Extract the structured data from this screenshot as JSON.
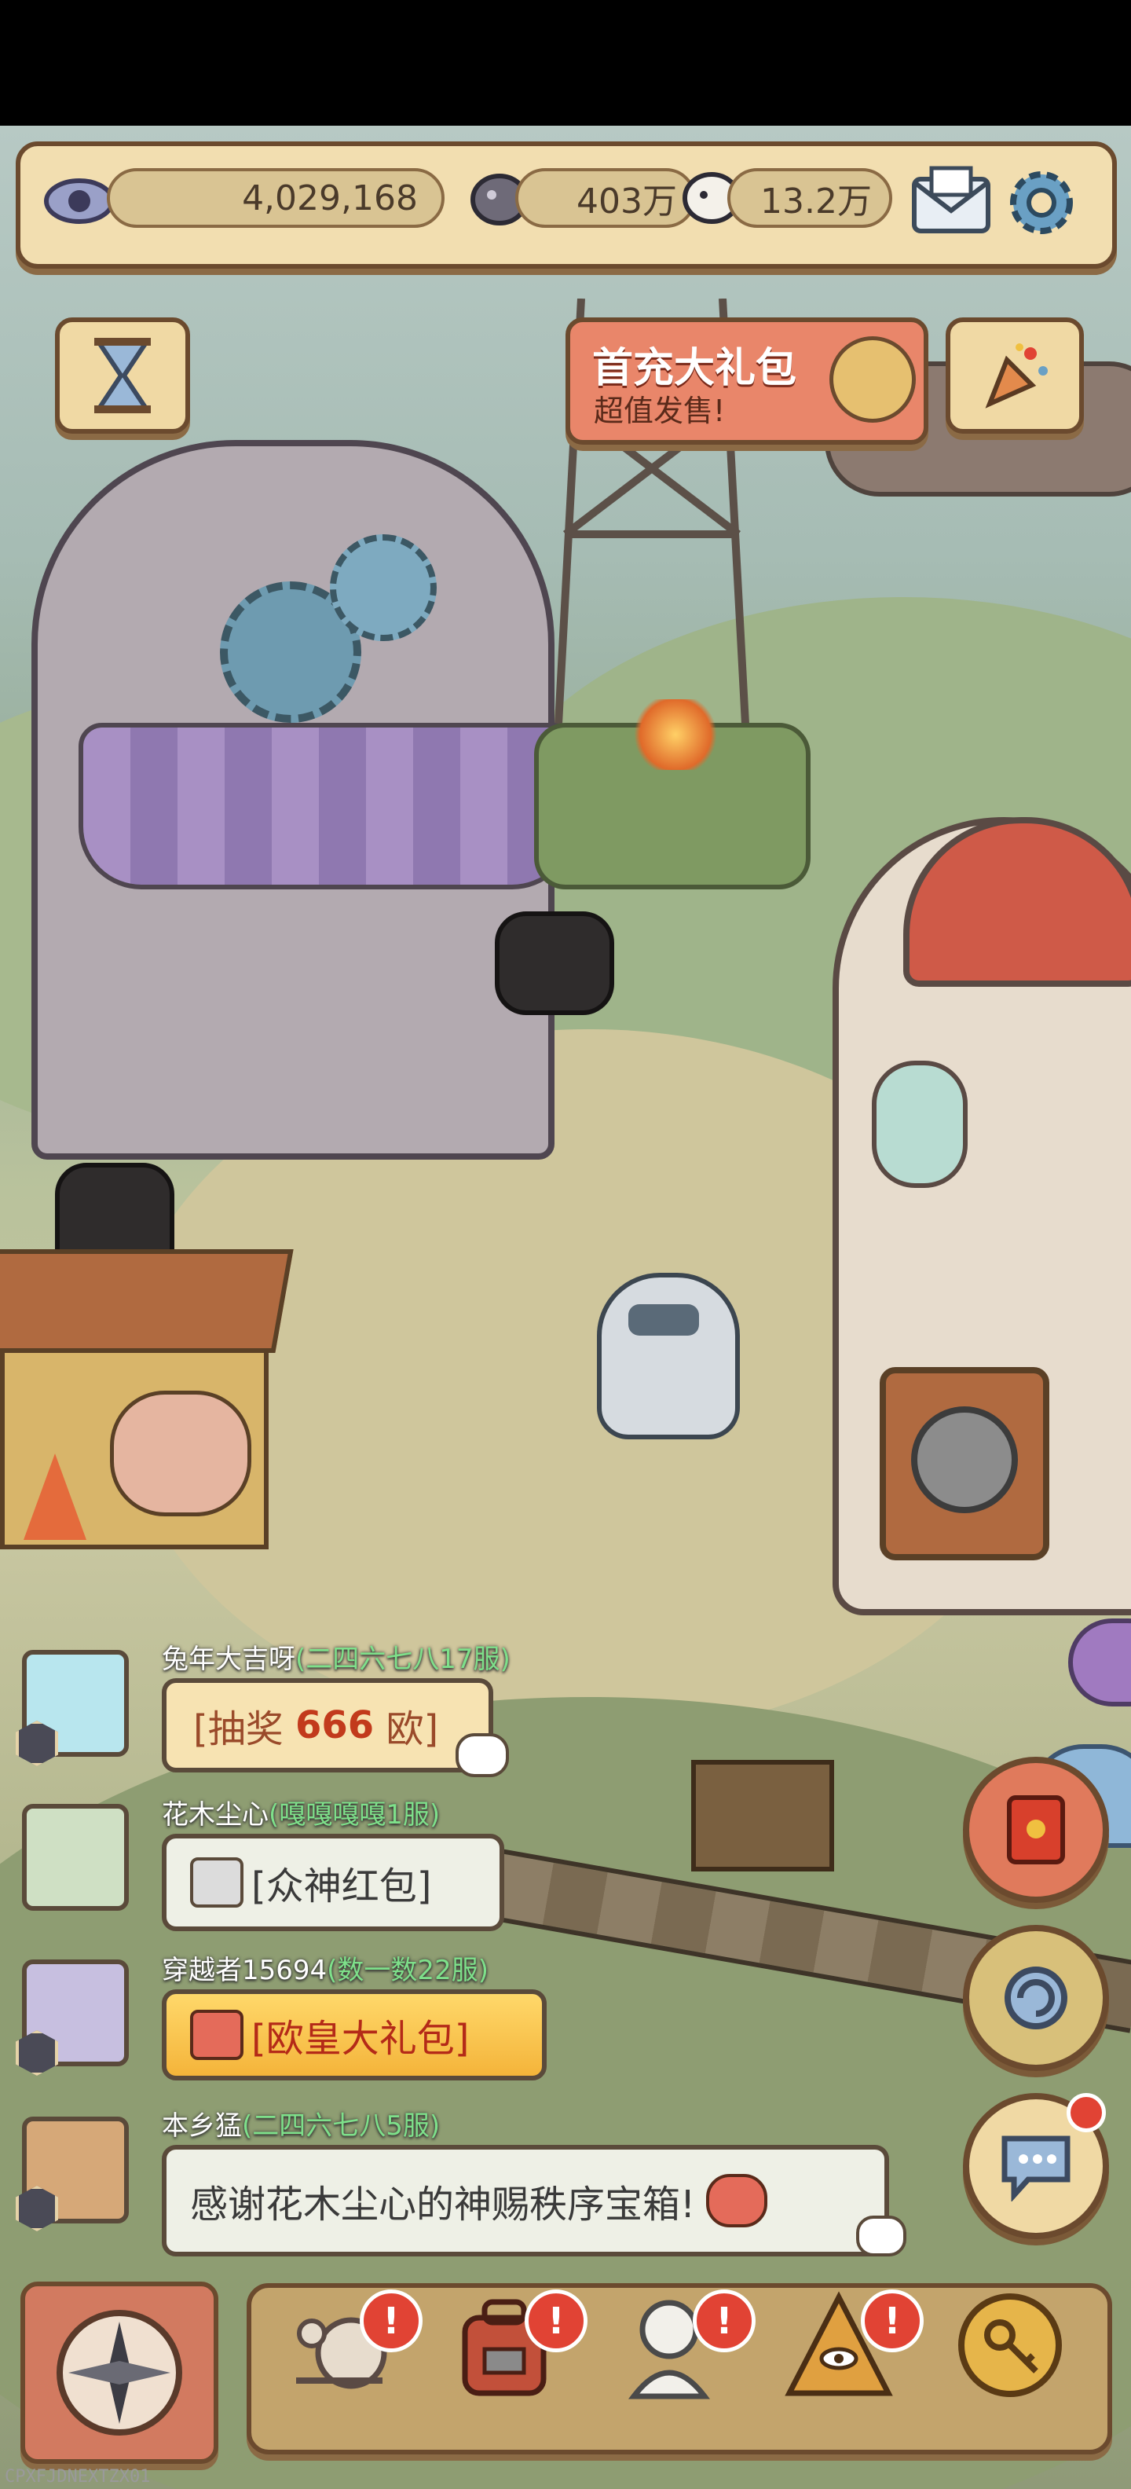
{
  "top_bar": {
    "views_count": "4,029,168",
    "coin_count": "403万",
    "bubble_count": "13.2万"
  },
  "banner": {
    "title": "首充大礼包",
    "subtitle": "超值发售!"
  },
  "chat": [
    {
      "user": "兔年大吉呀",
      "server": "(二四六七八17服)",
      "message_prefix": "[抽奖 ",
      "message_highlight": "666",
      "message_suffix": " 欧]"
    },
    {
      "user": "花木尘心",
      "server": "(嘎嘎嘎嘎1服)",
      "message": "[众神红包]"
    },
    {
      "user": "穿越者15694",
      "server": "(数一数22服)",
      "message": "[欧皇大礼包]"
    },
    {
      "user": "本乡猛",
      "server": "(二四六七八5服)",
      "message": "感谢花木尘心的神赐秩序宝箱!"
    }
  ],
  "alerts": {
    "nav_alert": "!"
  },
  "footer_code": "CPXFJDNEXTZX01",
  "colors": {
    "panel_fill": "#f2deb0",
    "panel_border": "#6b4a2e",
    "server_text": "#7ee08a",
    "lottery_highlight": "#c23a1c",
    "alert_red": "#e14334"
  }
}
